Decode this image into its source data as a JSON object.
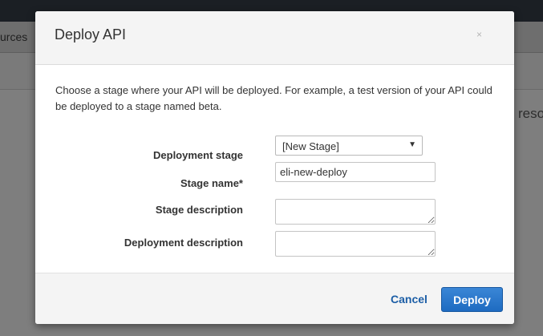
{
  "background": {
    "tab_text": "urces",
    "side_text": "reso"
  },
  "modal": {
    "title": "Deploy API",
    "close_glyph": "×",
    "intro": "Choose a stage where your API will be deployed. For example, a test version of your API could be deployed to a stage named beta.",
    "form": {
      "deployment_stage_label": "Deployment stage",
      "deployment_stage_value": "[New Stage]",
      "stage_name_label": "Stage name*",
      "stage_name_value": "eli-new-deploy",
      "stage_description_label": "Stage description",
      "deployment_description_label": "Deployment description"
    },
    "footer": {
      "cancel_label": "Cancel",
      "deploy_label": "Deploy"
    }
  },
  "icons": {
    "close": "close-icon",
    "dropdown": "chevron-down-icon"
  },
  "colors": {
    "primary_button": "#1e6bc1",
    "link": "#1c5ea6",
    "topbar": "#1b1f24"
  }
}
